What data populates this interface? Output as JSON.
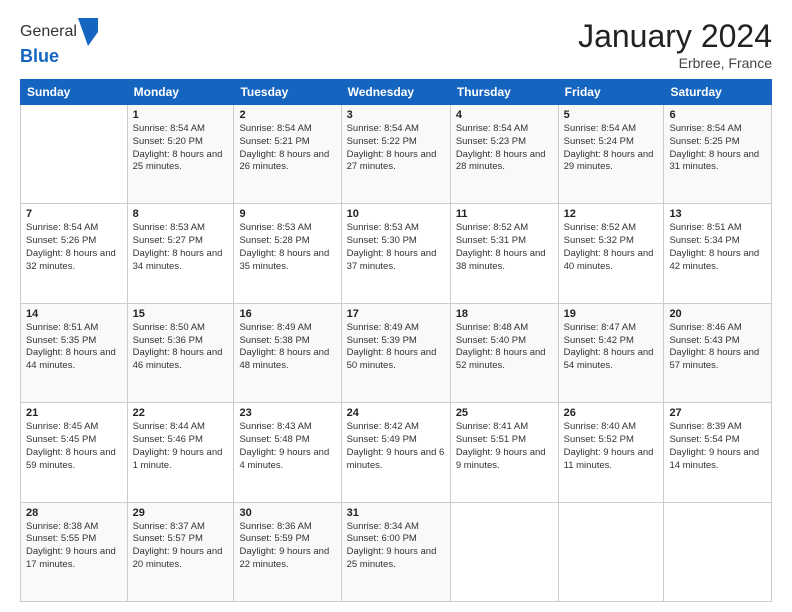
{
  "logo": {
    "general": "General",
    "blue": "Blue"
  },
  "title": "January 2024",
  "subtitle": "Erbree, France",
  "days_header": [
    "Sunday",
    "Monday",
    "Tuesday",
    "Wednesday",
    "Thursday",
    "Friday",
    "Saturday"
  ],
  "weeks": [
    [
      {
        "day": "",
        "sunrise": "",
        "sunset": "",
        "daylight": ""
      },
      {
        "day": "1",
        "sunrise": "Sunrise: 8:54 AM",
        "sunset": "Sunset: 5:20 PM",
        "daylight": "Daylight: 8 hours and 25 minutes."
      },
      {
        "day": "2",
        "sunrise": "Sunrise: 8:54 AM",
        "sunset": "Sunset: 5:21 PM",
        "daylight": "Daylight: 8 hours and 26 minutes."
      },
      {
        "day": "3",
        "sunrise": "Sunrise: 8:54 AM",
        "sunset": "Sunset: 5:22 PM",
        "daylight": "Daylight: 8 hours and 27 minutes."
      },
      {
        "day": "4",
        "sunrise": "Sunrise: 8:54 AM",
        "sunset": "Sunset: 5:23 PM",
        "daylight": "Daylight: 8 hours and 28 minutes."
      },
      {
        "day": "5",
        "sunrise": "Sunrise: 8:54 AM",
        "sunset": "Sunset: 5:24 PM",
        "daylight": "Daylight: 8 hours and 29 minutes."
      },
      {
        "day": "6",
        "sunrise": "Sunrise: 8:54 AM",
        "sunset": "Sunset: 5:25 PM",
        "daylight": "Daylight: 8 hours and 31 minutes."
      }
    ],
    [
      {
        "day": "7",
        "sunrise": "Sunrise: 8:54 AM",
        "sunset": "Sunset: 5:26 PM",
        "daylight": "Daylight: 8 hours and 32 minutes."
      },
      {
        "day": "8",
        "sunrise": "Sunrise: 8:53 AM",
        "sunset": "Sunset: 5:27 PM",
        "daylight": "Daylight: 8 hours and 34 minutes."
      },
      {
        "day": "9",
        "sunrise": "Sunrise: 8:53 AM",
        "sunset": "Sunset: 5:28 PM",
        "daylight": "Daylight: 8 hours and 35 minutes."
      },
      {
        "day": "10",
        "sunrise": "Sunrise: 8:53 AM",
        "sunset": "Sunset: 5:30 PM",
        "daylight": "Daylight: 8 hours and 37 minutes."
      },
      {
        "day": "11",
        "sunrise": "Sunrise: 8:52 AM",
        "sunset": "Sunset: 5:31 PM",
        "daylight": "Daylight: 8 hours and 38 minutes."
      },
      {
        "day": "12",
        "sunrise": "Sunrise: 8:52 AM",
        "sunset": "Sunset: 5:32 PM",
        "daylight": "Daylight: 8 hours and 40 minutes."
      },
      {
        "day": "13",
        "sunrise": "Sunrise: 8:51 AM",
        "sunset": "Sunset: 5:34 PM",
        "daylight": "Daylight: 8 hours and 42 minutes."
      }
    ],
    [
      {
        "day": "14",
        "sunrise": "Sunrise: 8:51 AM",
        "sunset": "Sunset: 5:35 PM",
        "daylight": "Daylight: 8 hours and 44 minutes."
      },
      {
        "day": "15",
        "sunrise": "Sunrise: 8:50 AM",
        "sunset": "Sunset: 5:36 PM",
        "daylight": "Daylight: 8 hours and 46 minutes."
      },
      {
        "day": "16",
        "sunrise": "Sunrise: 8:49 AM",
        "sunset": "Sunset: 5:38 PM",
        "daylight": "Daylight: 8 hours and 48 minutes."
      },
      {
        "day": "17",
        "sunrise": "Sunrise: 8:49 AM",
        "sunset": "Sunset: 5:39 PM",
        "daylight": "Daylight: 8 hours and 50 minutes."
      },
      {
        "day": "18",
        "sunrise": "Sunrise: 8:48 AM",
        "sunset": "Sunset: 5:40 PM",
        "daylight": "Daylight: 8 hours and 52 minutes."
      },
      {
        "day": "19",
        "sunrise": "Sunrise: 8:47 AM",
        "sunset": "Sunset: 5:42 PM",
        "daylight": "Daylight: 8 hours and 54 minutes."
      },
      {
        "day": "20",
        "sunrise": "Sunrise: 8:46 AM",
        "sunset": "Sunset: 5:43 PM",
        "daylight": "Daylight: 8 hours and 57 minutes."
      }
    ],
    [
      {
        "day": "21",
        "sunrise": "Sunrise: 8:45 AM",
        "sunset": "Sunset: 5:45 PM",
        "daylight": "Daylight: 8 hours and 59 minutes."
      },
      {
        "day": "22",
        "sunrise": "Sunrise: 8:44 AM",
        "sunset": "Sunset: 5:46 PM",
        "daylight": "Daylight: 9 hours and 1 minute."
      },
      {
        "day": "23",
        "sunrise": "Sunrise: 8:43 AM",
        "sunset": "Sunset: 5:48 PM",
        "daylight": "Daylight: 9 hours and 4 minutes."
      },
      {
        "day": "24",
        "sunrise": "Sunrise: 8:42 AM",
        "sunset": "Sunset: 5:49 PM",
        "daylight": "Daylight: 9 hours and 6 minutes."
      },
      {
        "day": "25",
        "sunrise": "Sunrise: 8:41 AM",
        "sunset": "Sunset: 5:51 PM",
        "daylight": "Daylight: 9 hours and 9 minutes."
      },
      {
        "day": "26",
        "sunrise": "Sunrise: 8:40 AM",
        "sunset": "Sunset: 5:52 PM",
        "daylight": "Daylight: 9 hours and 11 minutes."
      },
      {
        "day": "27",
        "sunrise": "Sunrise: 8:39 AM",
        "sunset": "Sunset: 5:54 PM",
        "daylight": "Daylight: 9 hours and 14 minutes."
      }
    ],
    [
      {
        "day": "28",
        "sunrise": "Sunrise: 8:38 AM",
        "sunset": "Sunset: 5:55 PM",
        "daylight": "Daylight: 9 hours and 17 minutes."
      },
      {
        "day": "29",
        "sunrise": "Sunrise: 8:37 AM",
        "sunset": "Sunset: 5:57 PM",
        "daylight": "Daylight: 9 hours and 20 minutes."
      },
      {
        "day": "30",
        "sunrise": "Sunrise: 8:36 AM",
        "sunset": "Sunset: 5:59 PM",
        "daylight": "Daylight: 9 hours and 22 minutes."
      },
      {
        "day": "31",
        "sunrise": "Sunrise: 8:34 AM",
        "sunset": "Sunset: 6:00 PM",
        "daylight": "Daylight: 9 hours and 25 minutes."
      },
      {
        "day": "",
        "sunrise": "",
        "sunset": "",
        "daylight": ""
      },
      {
        "day": "",
        "sunrise": "",
        "sunset": "",
        "daylight": ""
      },
      {
        "day": "",
        "sunrise": "",
        "sunset": "",
        "daylight": ""
      }
    ]
  ]
}
